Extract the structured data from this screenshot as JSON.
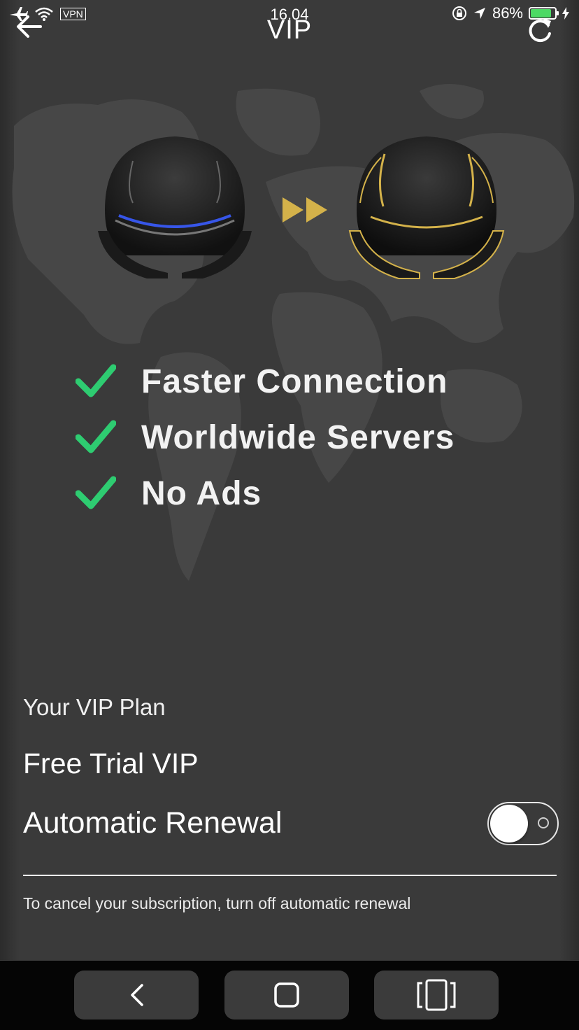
{
  "status_bar": {
    "vpn": "VPN",
    "time": "16.04",
    "battery": "86%",
    "battery_level": 0.86,
    "icons": [
      "airplane-icon",
      "wifi-icon",
      "rotation-lock-icon",
      "location-icon",
      "charging-icon"
    ]
  },
  "header": {
    "title": "VIP",
    "back_icon": "back-arrow-icon",
    "refresh_icon": "refresh-icon"
  },
  "features": [
    {
      "label": "Faster Connection",
      "icon": "check-icon"
    },
    {
      "label": "Worldwide Servers",
      "icon": "check-icon"
    },
    {
      "label": "No Ads",
      "icon": "check-icon"
    }
  ],
  "plan": {
    "heading": "Your VIP Plan",
    "name": "Free Trial VIP",
    "auto_renew_label": "Automatic Renewal",
    "auto_renew_on": false,
    "cancel_note": "To cancel your subscription, turn off automatic renewal"
  },
  "colors": {
    "background": "#3a3a3a",
    "check": "#2ecc71",
    "gold": "#d4b24a",
    "blue_glow": "#3a5cff"
  },
  "system_nav": [
    "back-icon",
    "home-icon",
    "recent-apps-icon"
  ]
}
